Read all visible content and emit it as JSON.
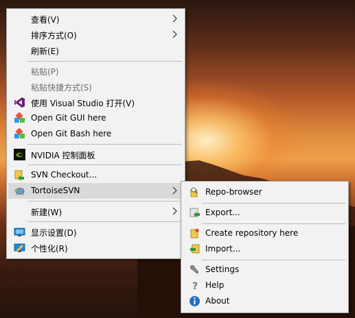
{
  "main_menu": {
    "view": "查看(V)",
    "sort": "排序方式(O)",
    "refresh": "刷新(E)",
    "paste": "粘贴(P)",
    "paste_shortcut": "粘贴快捷方式(S)",
    "open_vs": "使用 Visual Studio 打开(V)",
    "git_gui": "Open Git GUI here",
    "git_bash": "Open Git Bash here",
    "nvidia": "NVIDIA 控制面板",
    "svn_checkout": "SVN Checkout...",
    "tortoise": "TortoiseSVN",
    "new": "新建(W)",
    "display": "显示设置(D)",
    "personalize": "个性化(R)"
  },
  "sub_menu": {
    "repo_browser": "Repo-browser",
    "export": "Export...",
    "create_repo": "Create repository here",
    "import": "Import...",
    "settings": "Settings",
    "help": "Help",
    "about": "About"
  },
  "colors": {
    "menu_bg": "#f2f2f2",
    "highlight": "#dadada",
    "disabled_text": "#6d6d6d",
    "vs_purple": "#68217a",
    "git_orange": "#f05133",
    "nvidia_green": "#76b900"
  }
}
